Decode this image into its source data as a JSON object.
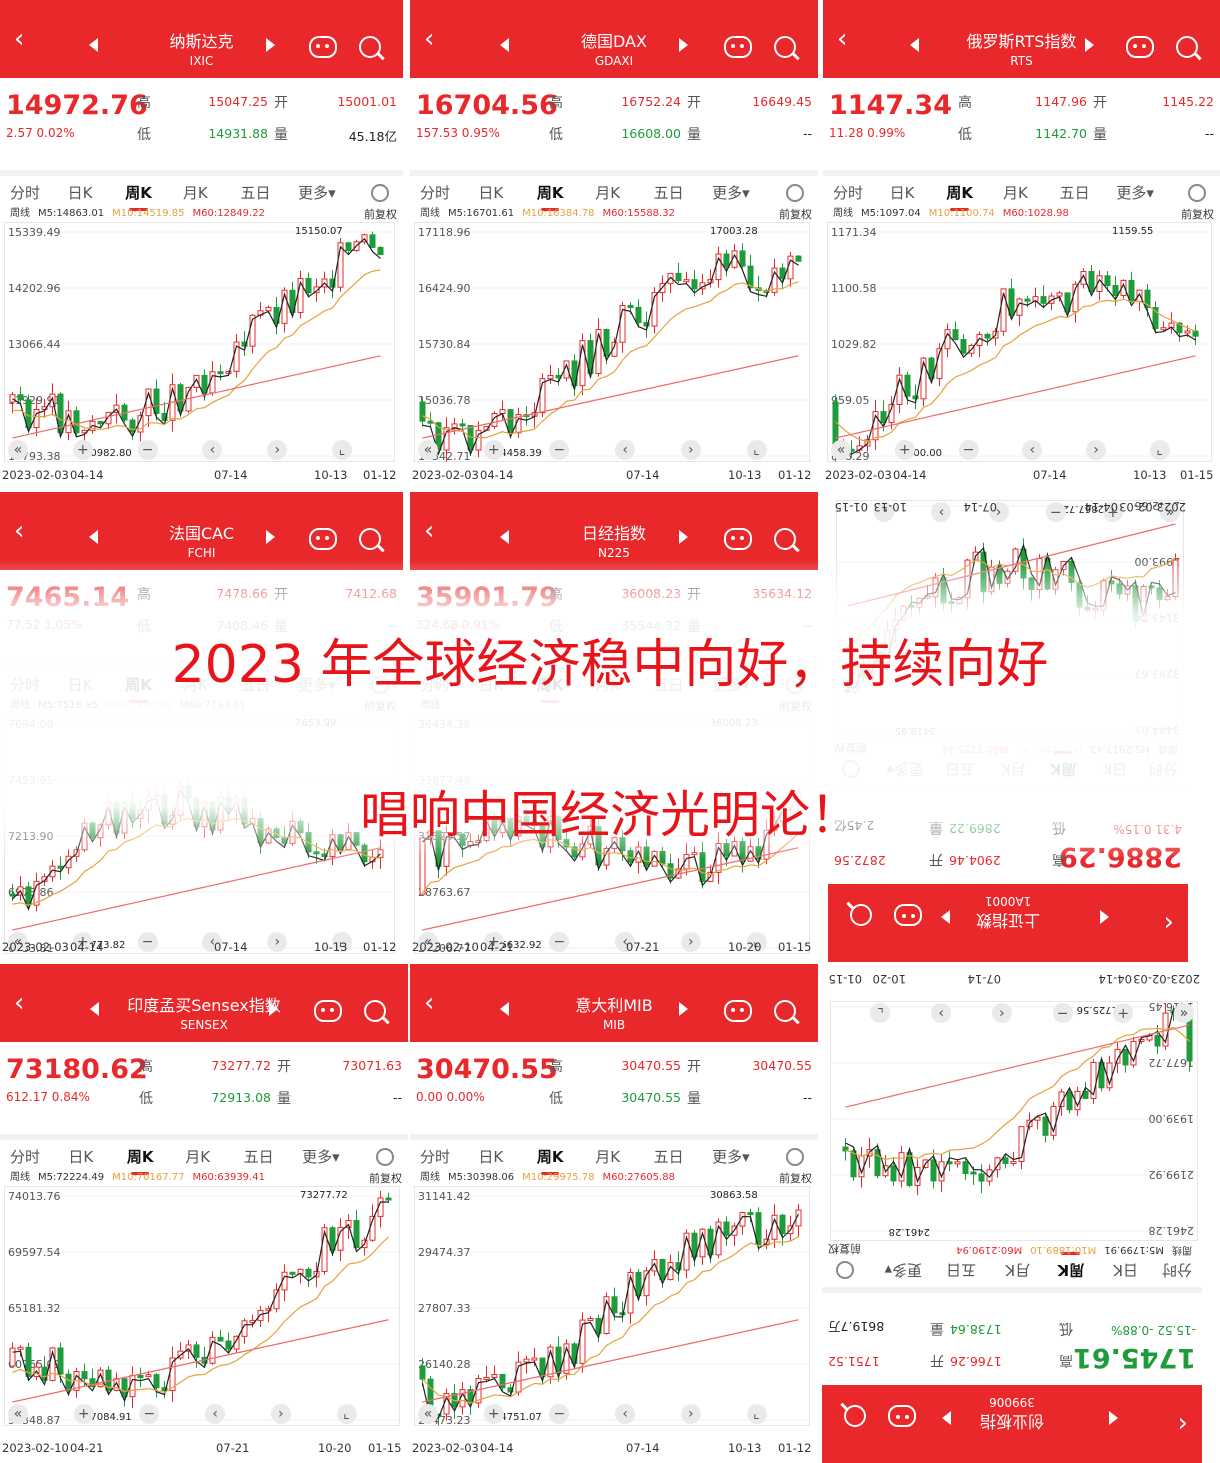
{
  "headline": "2023 年全球经济稳中向好，持续向好",
  "subheadline": "唱响中国经济光明论！",
  "tabs": [
    "分时",
    "日K",
    "周K",
    "月K",
    "五日",
    "更多▾"
  ],
  "labels": {
    "high": "高",
    "low": "低",
    "open": "开",
    "vol": "量",
    "fq": "前复权",
    "ma_prefix": "周线"
  },
  "panels": [
    {
      "name": "纳斯达克",
      "code": "IXIC",
      "price": "14972.76",
      "chg": "2.57  0.02%",
      "high": "15047.25",
      "low": "14931.88",
      "open": "15001.01",
      "vol": "45.18亿",
      "ma5": "M5:14863.01",
      "ma10": "M10:14519.85",
      "ma60": "M60:12849.22",
      "ylabels": [
        "15339.49",
        "14202.96",
        "13066.44",
        "11929.91",
        "10793.38"
      ],
      "annot_hi": "15150.07",
      "annot_lo": "10982.80",
      "xlabels": [
        "2023-02-03",
        "04-14",
        "07-14",
        "10-13",
        "01-12"
      ]
    },
    {
      "name": "德国DAX",
      "code": "GDAXI",
      "price": "16704.56",
      "chg": "157.53  0.95%",
      "high": "16752.24",
      "low": "16608.00",
      "open": "16649.45",
      "vol": "--",
      "ma5": "M5:16701.61",
      "ma10": "M10:16384.78",
      "ma60": "M60:15588.32",
      "ylabels": [
        "17118.96",
        "16424.90",
        "15730.84",
        "15036.78",
        "14342.71"
      ],
      "annot_hi": "17003.28",
      "annot_lo": "14458.39",
      "xlabels": [
        "2023-02-03",
        "04-14",
        "07-14",
        "10-13",
        "01-12"
      ]
    },
    {
      "name": "俄罗斯RTS指数",
      "code": "RTS",
      "price": "1147.34",
      "chg": "11.28  0.99%",
      "high": "1147.96",
      "low": "1142.70",
      "open": "1145.22",
      "vol": "--",
      "ma5": "M5:1097.04",
      "ma10": "M10:1100.74",
      "ma60": "M60:1028.98",
      "ylabels": [
        "1171.34",
        "1100.58",
        "1029.82",
        "959.05",
        "888.29"
      ],
      "annot_hi": "1159.55",
      "annot_lo": "900.00",
      "xlabels": [
        "2023-02-03",
        "04-14",
        "07-14",
        "10-13",
        "01-15"
      ]
    },
    {
      "name": "法国CAC",
      "code": "FCHI",
      "price": "7465.14",
      "chg": "77.52  1.05%",
      "high": "7478.66",
      "low": "7408.46",
      "open": "7412.68",
      "vol": "--",
      "ma5": "M5:7518.95",
      "ma10": "M10:7403.92",
      "ma60": "M60:7193.61",
      "ylabels": [
        "7694.00",
        "7453.95",
        "7213.90",
        "6973.86",
        "6733.81"
      ],
      "annot_hi": "7653.99",
      "annot_lo": "6773.82",
      "xlabels": [
        "2023-02-03",
        "04-14",
        "07-14",
        "10-13",
        "01-12"
      ]
    },
    {
      "name": "日经指数",
      "code": "N225",
      "price": "35901.79",
      "chg": "324.68  0.91%",
      "high": "36008.23",
      "low": "35544.32",
      "open": "35634.12",
      "vol": "--",
      "ma5": "",
      "ma10": "",
      "ma60": "",
      "ylabels": [
        "36434.38",
        "33877.48",
        "31320.57",
        "28763.67",
        "26206.77"
      ],
      "annot_hi": "36008.23",
      "annot_lo": "26632.92",
      "xlabels": [
        "2023-02-10",
        "04-21",
        "07-21",
        "10-20",
        "01-15"
      ]
    },
    {
      "name": "上证指数",
      "code": "1A0001",
      "price": "2886.29",
      "chg": "4.31  0.15%",
      "high": "2904.46",
      "low": "2869.22",
      "open": "2872.56",
      "vol": "2.45亿",
      "ma5": "M5:2917.43",
      "ma10": "M10:2962.43",
      "ma60": "M60:3155.34",
      "ylabels": [
        "3444.01",
        "3293.67",
        "3143.34",
        "2993.00",
        "2842.66"
      ],
      "annot_hi": "3418.95",
      "annot_lo": "2867.72",
      "xlabels": [
        "2023-02-03",
        "04-14",
        "07-14",
        "10-13",
        "01-15"
      ],
      "mirrored": true
    },
    {
      "name": "印度孟买Sensex指数",
      "code": "SENSEX",
      "price": "73180.62",
      "chg": "612.17  0.84%",
      "high": "73277.72",
      "low": "72913.08",
      "open": "73071.63",
      "vol": "--",
      "ma5": "M5:72224.49",
      "ma10": "M10:70167.77",
      "ma60": "M60:63939.41",
      "ylabels": [
        "74013.76",
        "69597.54",
        "65181.32",
        "60765.09",
        "56348.87"
      ],
      "annot_hi": "73277.72",
      "annot_lo": "57084.91",
      "xlabels": [
        "2023-02-10",
        "04-21",
        "07-21",
        "10-20",
        "01-15"
      ]
    },
    {
      "name": "意大利MIB",
      "code": "MIB",
      "price": "30470.55",
      "chg": "0.00  0.00%",
      "high": "30470.55",
      "low": "30470.55",
      "open": "30470.55",
      "vol": "--",
      "ma5": "M5:30398.06",
      "ma10": "M10:29975.78",
      "ma60": "M60:27605.88",
      "ylabels": [
        "31141.42",
        "29474.37",
        "27807.33",
        "26140.28",
        "24473.23"
      ],
      "annot_hi": "30863.58",
      "annot_lo": "24751.07",
      "xlabels": [
        "2023-02-03",
        "04-14",
        "07-14",
        "10-13",
        "01-12"
      ]
    },
    {
      "name": "创业板指",
      "code": "399006",
      "price": "1745.61",
      "chg": "-15.52  -0.88%",
      "high": "1766.26",
      "low": "1738.64",
      "open": "1751.52",
      "vol": "8619.7万",
      "ma5": "M5:1799.91",
      "ma10": "M10:1889.10",
      "ma60": "M60:2190.94",
      "ylabels": [
        "2461.28",
        "2199.92",
        "1939.00",
        "1677.72",
        "1416.45"
      ],
      "annot_hi": "2461.28",
      "annot_lo": "1725.56",
      "xlabels": [
        "2023-02-03",
        "04-14",
        "07-14",
        "10-20",
        "01-15"
      ],
      "mirrored": true
    }
  ],
  "colors": {
    "brand": "#e8282b",
    "up": "#e8282b",
    "down": "#1e9b3a",
    "ma5": "#222222",
    "ma10": "#e6a23c",
    "ma60": "#e8282b"
  }
}
